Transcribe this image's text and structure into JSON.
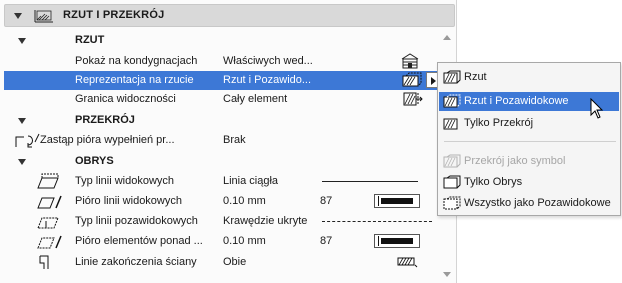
{
  "panel": {
    "title": "RZUT I PRZEKRÓJ",
    "icon": "floor-plan-section-icon"
  },
  "sections": {
    "rzut": {
      "title": "RZUT",
      "rows": [
        {
          "label": "Pokaż na kondygnacjach",
          "value": "Właściwych wed...",
          "icon": "stories-icon"
        },
        {
          "label": "Reprezentacja na rzucie",
          "value": "Rzut i Pozawido...",
          "icon": "cut-projected-icon"
        },
        {
          "label": "Granica widoczności",
          "value": "Cały element",
          "icon": "visibility-limit-icon"
        }
      ]
    },
    "przekroj": {
      "title": "PRZEKRÓJ",
      "rows": [
        {
          "label": "Zastąp pióra wypełnień pr...",
          "value": "Brak",
          "icon": "override-pen-icon"
        }
      ]
    },
    "obrys": {
      "title": "OBRYS",
      "rows": [
        {
          "label": "Typ linii widokowych",
          "value": "Linia ciągła",
          "icon": "visible-line-type-icon"
        },
        {
          "label": "Pióro linii widokowych",
          "value": "0.10 mm",
          "pen": "87",
          "icon": "visible-line-pen-icon"
        },
        {
          "label": "Typ linii pozawidokowych",
          "value": "Krawędzie ukryte",
          "icon": "overhead-line-type-icon"
        },
        {
          "label": "Pióro elementów ponad ...",
          "value": "0.10 mm",
          "pen": "87",
          "icon": "overhead-pen-icon"
        },
        {
          "label": "Linie zakończenia ściany",
          "value": "Obie",
          "icon": "wall-end-lines-icon"
        }
      ]
    }
  },
  "menu": {
    "items": [
      {
        "label": "Rzut",
        "icon": "projection-icon",
        "state": "normal"
      },
      {
        "label": "Rzut i Pozawidokowe",
        "icon": "projection-overhead-icon",
        "state": "highlighted"
      },
      {
        "label": "Tylko Przekrój",
        "icon": "section-only-icon",
        "state": "normal"
      },
      {
        "label": "Przekrój jako symbol",
        "icon": "section-symbol-icon",
        "state": "disabled"
      },
      {
        "label": "Tylko Obrys",
        "icon": "outline-only-icon",
        "state": "normal"
      },
      {
        "label": "Wszystko jako Pozawidokowe",
        "icon": "all-overhead-icon",
        "state": "normal"
      }
    ]
  },
  "colors": {
    "selection": "#3d78d6",
    "header_bg": "#d9d9d9",
    "disabled_text": "#a6a6a6"
  }
}
